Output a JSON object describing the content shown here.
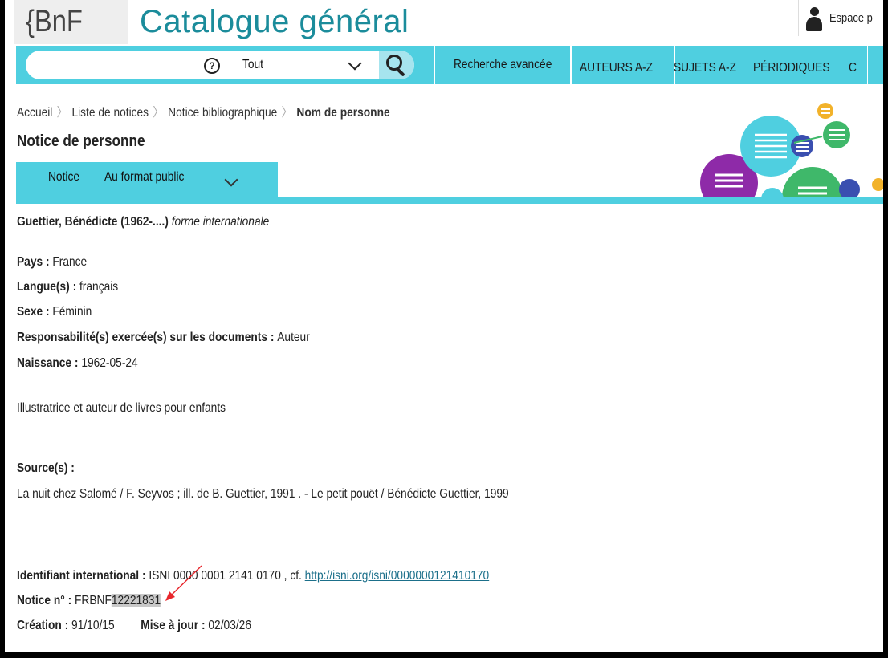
{
  "header": {
    "logo": "{BnF",
    "title": "Catalogue général",
    "account": "Espace p"
  },
  "search": {
    "value": "",
    "help": "?",
    "scope": "Tout",
    "advanced": "Recherche avancée"
  },
  "nav": {
    "tabs": [
      "AUTEURS A-Z",
      "SUJETS A-Z",
      "PÉRIODIQUES",
      "C"
    ]
  },
  "breadcrumb": [
    "Accueil",
    "Liste de notices",
    "Notice bibliographique",
    "Nom de personne"
  ],
  "page_title": "Notice de personne",
  "view_tab": {
    "label": "Notice",
    "format": "Au format public"
  },
  "record": {
    "heading": "Guettier, Bénédicte (1962-....)",
    "heading_note": "forme internationale",
    "fields": [
      {
        "label": "Pays",
        "value": "France"
      },
      {
        "label": "Langue(s)",
        "value": "français"
      },
      {
        "label": "Sexe",
        "value": "Féminin"
      },
      {
        "label": "Responsabilité(s) exercée(s) sur les documents",
        "value": "Auteur"
      },
      {
        "label": "Naissance",
        "value": "1962-05-24"
      }
    ],
    "description": "Illustratrice et auteur de livres pour enfants",
    "sources_label": "Source(s) :",
    "sources": "La nuit chez Salomé / F. Seyvos ; ill. de B. Guettier, 1991 . - Le petit pouët / Bénédicte Guettier, 1999",
    "isni_label": "Identifiant international :",
    "isni_value": "ISNI 0000 0001 2141 0170 , cf.",
    "isni_link": "http://isni.org/isni/0000000121410170",
    "notice_label": "Notice n° :",
    "notice_prefix": "FRBNF",
    "notice_number": "12221831",
    "creation_label": "Création :",
    "creation_value": "91/10/15",
    "update_label": "Mise à jour :",
    "update_value": "02/03/26"
  },
  "colors": {
    "accent": "#4fcfe0",
    "title": "#1b8c9b",
    "link": "#1b6f8a",
    "annotation_arrow": "#e8262c"
  }
}
